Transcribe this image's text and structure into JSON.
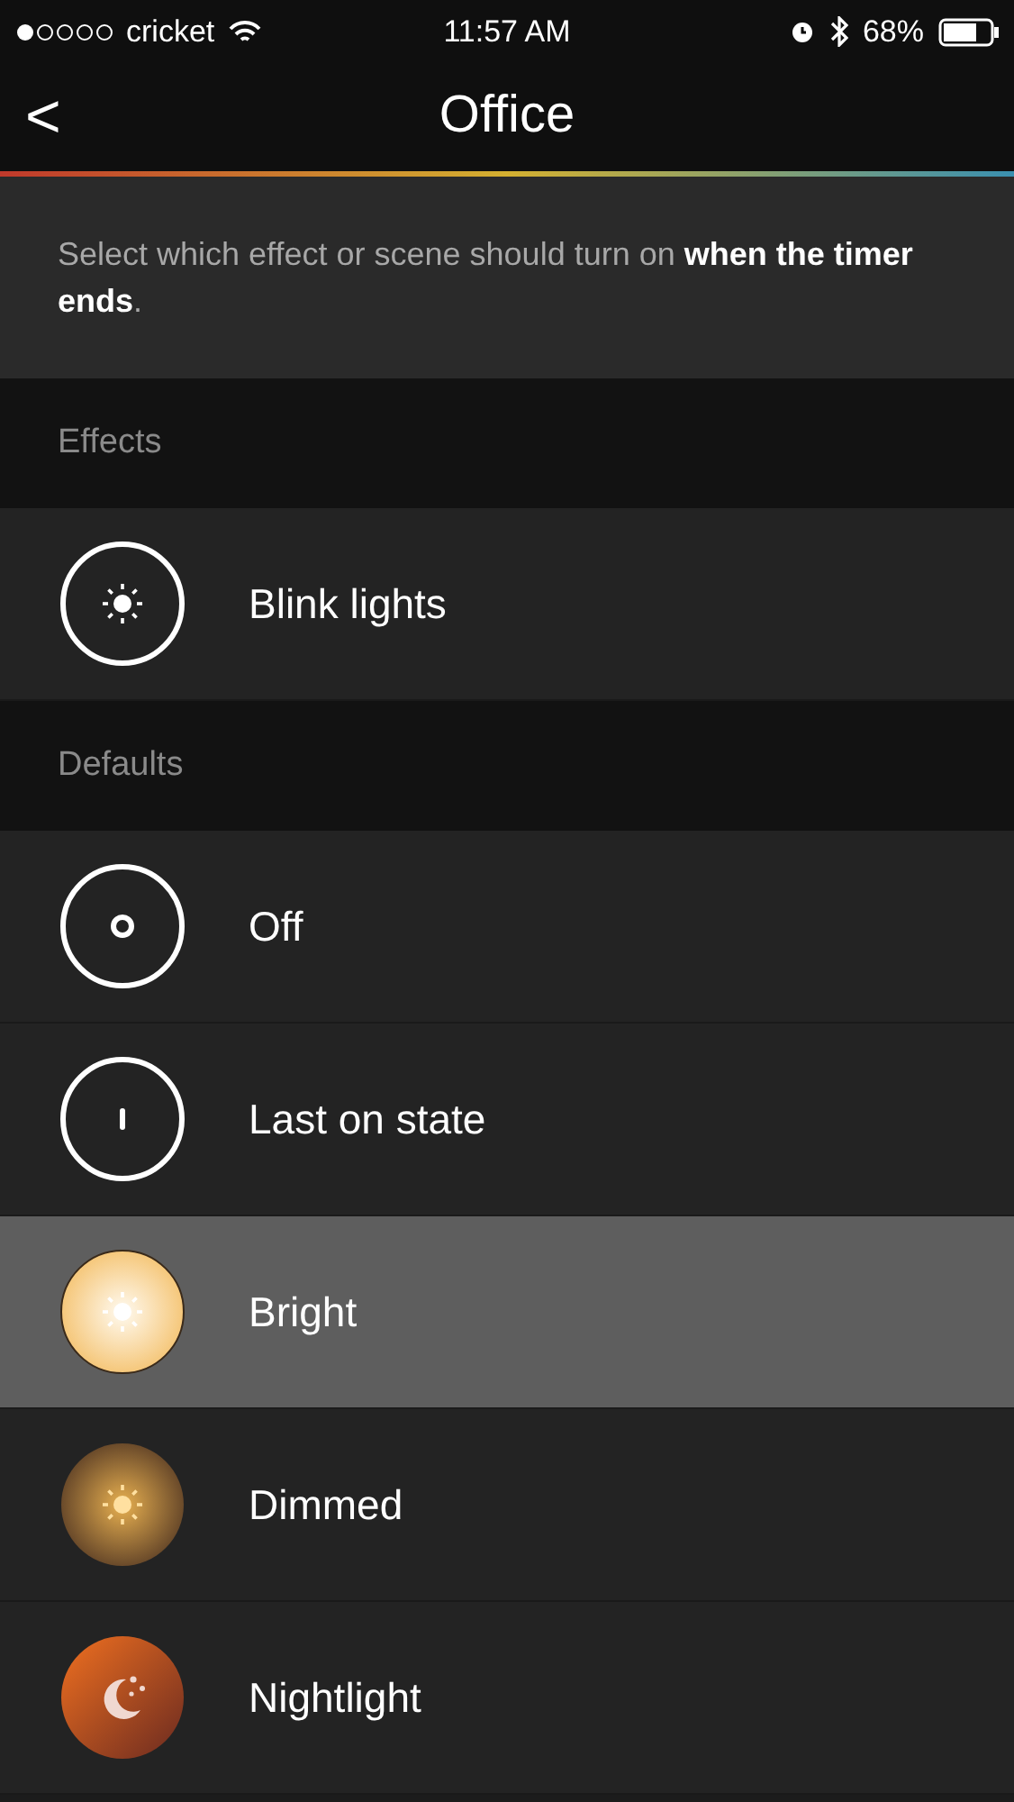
{
  "status_bar": {
    "carrier": "cricket",
    "time": "11:57 AM",
    "battery": "68%"
  },
  "nav": {
    "back": "<",
    "title": "Office"
  },
  "description": "Select which effect or scene should turn on **when the timer ends**.",
  "sections": [
    {
      "title": "Effects",
      "items": [
        {
          "label": "Blink lights",
          "kind": "blink",
          "selected": false
        }
      ]
    },
    {
      "title": "Defaults",
      "items": [
        {
          "label": "Off",
          "kind": "off",
          "selected": false
        },
        {
          "label": "Last on state",
          "kind": "last",
          "selected": false
        },
        {
          "label": "Bright",
          "kind": "bright",
          "selected": true
        },
        {
          "label": "Dimmed",
          "kind": "dimmed",
          "selected": false
        },
        {
          "label": "Nightlight",
          "kind": "nightlight",
          "selected": false
        }
      ]
    }
  ]
}
